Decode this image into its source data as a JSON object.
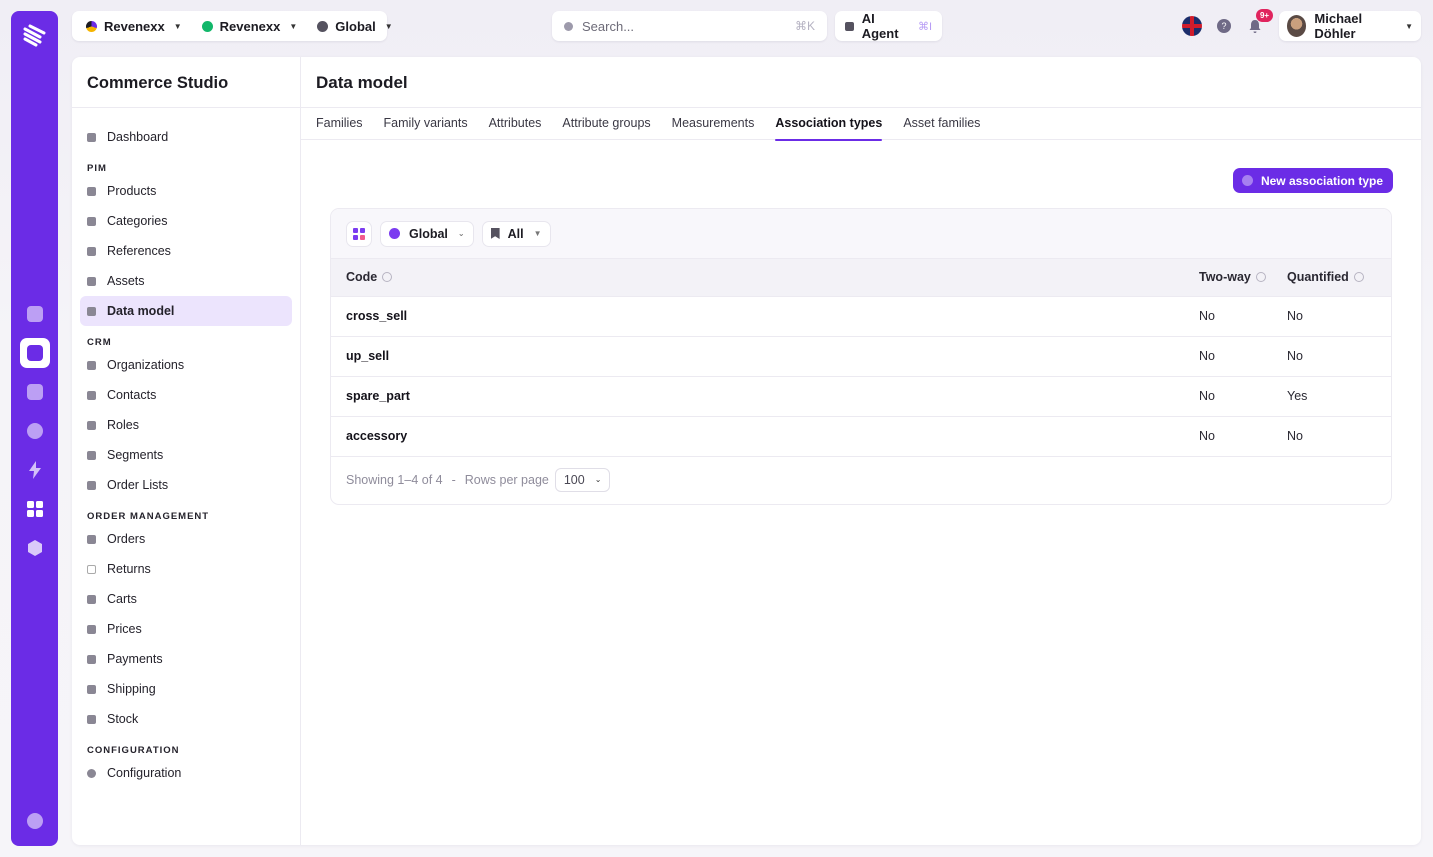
{
  "topbar": {
    "org": "Revenexx",
    "store": "Revenexx",
    "scope": "Global",
    "search_placeholder": "Search...",
    "search_shortcut": "⌘K",
    "ai_label": "AI Agent",
    "ai_shortcut": "⌘I",
    "notifications_badge": "9+",
    "user_name": "Michael Döhler"
  },
  "sidebar": {
    "title": "Commerce Studio",
    "dashboard": "Dashboard",
    "sections": {
      "pim": "PIM",
      "crm": "CRM",
      "order_management": "ORDER MANAGEMENT",
      "configuration": "CONFIGURATION"
    },
    "pim_items": [
      "Products",
      "Categories",
      "References",
      "Assets",
      "Data model"
    ],
    "crm_items": [
      "Organizations",
      "Contacts",
      "Roles",
      "Segments",
      "Order Lists"
    ],
    "order_items": [
      "Orders",
      "Returns",
      "Carts",
      "Prices",
      "Payments",
      "Shipping",
      "Stock"
    ],
    "config_items": [
      "Configuration"
    ],
    "active": "Data model"
  },
  "page": {
    "title": "Data model",
    "tabs": [
      "Families",
      "Family variants",
      "Attributes",
      "Attribute groups",
      "Measurements",
      "Association types",
      "Asset families"
    ],
    "active_tab": "Association types",
    "new_button": "New association type"
  },
  "filters": {
    "scope": "Global",
    "all": "All"
  },
  "table": {
    "headers": {
      "code": "Code",
      "two_way": "Two-way",
      "quantified": "Quantified"
    },
    "rows": [
      {
        "code": "cross_sell",
        "two_way": "No",
        "quantified": "No"
      },
      {
        "code": "up_sell",
        "two_way": "No",
        "quantified": "No"
      },
      {
        "code": "spare_part",
        "two_way": "No",
        "quantified": "Yes"
      },
      {
        "code": "accessory",
        "two_way": "No",
        "quantified": "No"
      }
    ]
  },
  "pager": {
    "showing": "Showing 1–4 of 4",
    "separator": "-",
    "rows_label": "Rows per page",
    "rows_value": "100"
  },
  "colors": {
    "accent": "#6b2ce6",
    "badge": "#e0245e"
  }
}
